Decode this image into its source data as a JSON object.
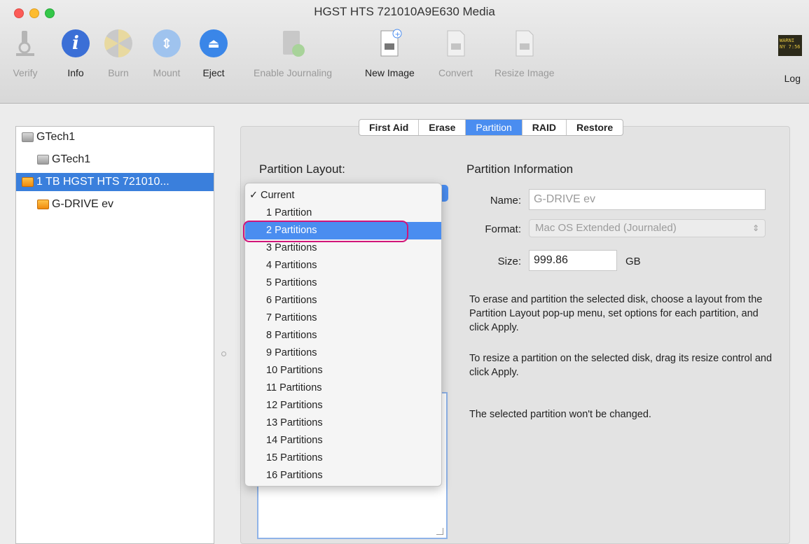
{
  "window": {
    "title": "HGST HTS 721010A9E630 Media"
  },
  "toolbar": {
    "verify": "Verify",
    "info": "Info",
    "burn": "Burn",
    "mount": "Mount",
    "eject": "Eject",
    "enable_journaling": "Enable Journaling",
    "new_image": "New Image",
    "convert": "Convert",
    "resize_image": "Resize Image",
    "log": "Log",
    "log_badge": "WARNI\nNY 7:56"
  },
  "sidebar": {
    "items": [
      {
        "label": "GTech1"
      },
      {
        "label": "GTech1"
      },
      {
        "label": "1 TB HGST HTS 721010..."
      },
      {
        "label": "G-DRIVE ev"
      }
    ]
  },
  "tabs": [
    "First Aid",
    "Erase",
    "Partition",
    "RAID",
    "Restore"
  ],
  "partition_layout": {
    "title": "Partition Layout:",
    "options": [
      "Current",
      "1 Partition",
      "2 Partitions",
      "3 Partitions",
      "4 Partitions",
      "5 Partitions",
      "6 Partitions",
      "7 Partitions",
      "8 Partitions",
      "9 Partitions",
      "10 Partitions",
      "11 Partitions",
      "12 Partitions",
      "13 Partitions",
      "14 Partitions",
      "15 Partitions",
      "16 Partitions"
    ],
    "checkmark": "✓"
  },
  "partition_info": {
    "title": "Partition Information",
    "name_label": "Name:",
    "name_value": "G-DRIVE ev",
    "format_label": "Format:",
    "format_value": "Mac OS Extended (Journaled)",
    "size_label": "Size:",
    "size_value": "999.86",
    "size_unit": "GB",
    "desc1": "To erase and partition the selected disk, choose a layout from the Partition Layout pop-up menu, set options for each partition, and click Apply.",
    "desc2": "To resize a partition on the selected disk, drag its resize control and click Apply.",
    "desc3": "The selected partition won't be changed."
  }
}
